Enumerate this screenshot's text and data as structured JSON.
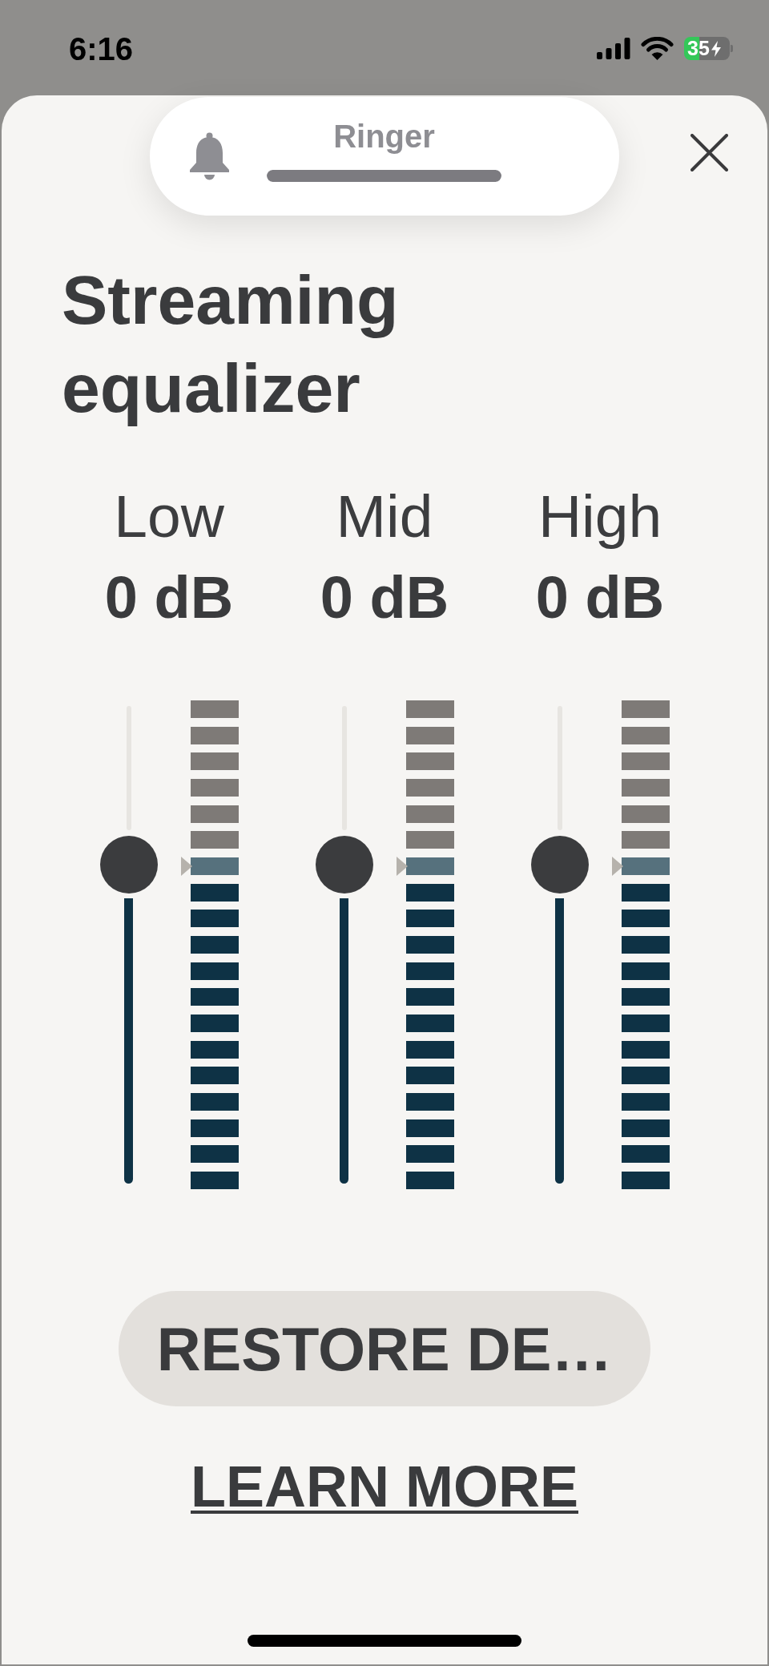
{
  "status_bar": {
    "time": "6:16",
    "battery": "35"
  },
  "ringer_hud": {
    "label": "Ringer",
    "level": 1
  },
  "title": "Streaming equalizer",
  "bands": [
    {
      "name": "Low",
      "reading": "0 dB",
      "level": 0.667
    },
    {
      "name": "Mid",
      "reading": "0 dB",
      "level": 0.667
    },
    {
      "name": "High",
      "reading": "0 dB",
      "level": 0.667
    }
  ],
  "restore_button": {
    "label": "RESTORE DE…"
  },
  "learn_more_link": {
    "label": "LEARN MORE"
  }
}
